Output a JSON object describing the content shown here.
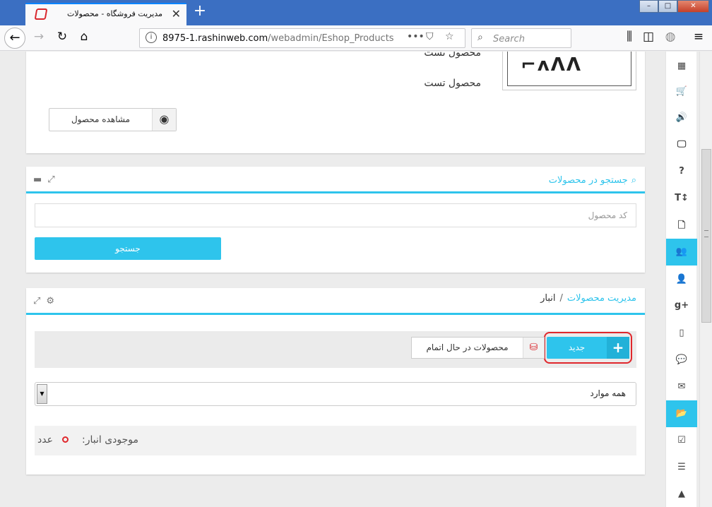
{
  "browser": {
    "tab_title": "مدیریت فروشگاه - محصولات",
    "new_tab_symbol": "+",
    "url_host": "8975-1.rashinweb.com",
    "url_path": "/webadmin/Eshop_Products",
    "search_placeholder": "Search",
    "window": {
      "minimize": "–",
      "maximize": "□",
      "close": "✕"
    }
  },
  "product": {
    "name_line1": "محصول تست",
    "name_line2": "محصول تست",
    "view_button": "مشاهده محصول",
    "image_logo_text": "ɅɅɅɅ-⌐ʌɅɅ"
  },
  "search_panel": {
    "title": "جستجو در محصولات",
    "code_placeholder": "کد محصول",
    "search_button": "جستجو"
  },
  "manage_panel": {
    "breadcrumb_link": "مدیریت محصولات",
    "breadcrumb_separator": "/",
    "breadcrumb_current": "انبار",
    "new_button": "جدید",
    "pending_button": "محصولات در حال اتمام",
    "filter_selected": "همه موارد",
    "stock_label": "موجودی انبار:",
    "stock_unit": "عدد"
  },
  "rail": {
    "items": [
      {
        "icon": "film-icon",
        "glyph": "▦"
      },
      {
        "icon": "cart-icon",
        "glyph": "🛒"
      },
      {
        "icon": "volume-icon",
        "glyph": "🔊"
      },
      {
        "icon": "monitor-icon",
        "glyph": "🖵"
      },
      {
        "icon": "question-icon",
        "glyph": "?"
      },
      {
        "icon": "text-height-icon",
        "glyph": "T↕"
      },
      {
        "icon": "file-icon",
        "glyph": "🗋"
      },
      {
        "icon": "users-icon",
        "glyph": "👥"
      },
      {
        "icon": "user-icon",
        "glyph": "👤"
      },
      {
        "icon": "google-plus-icon",
        "glyph": "g+"
      },
      {
        "icon": "mobile-icon",
        "glyph": "▯"
      },
      {
        "icon": "comments-icon",
        "glyph": "💬"
      },
      {
        "icon": "envelope-icon",
        "glyph": "✉"
      },
      {
        "icon": "folder-open-icon",
        "glyph": "📂"
      },
      {
        "icon": "check-square-icon",
        "glyph": "☑"
      },
      {
        "icon": "list-icon",
        "glyph": "☰"
      },
      {
        "icon": "road-icon",
        "glyph": "▲"
      }
    ]
  },
  "colors": {
    "accent": "#2ec4ec",
    "highlight_red": "#e0272c",
    "titlebar": "#3b6fc2"
  }
}
